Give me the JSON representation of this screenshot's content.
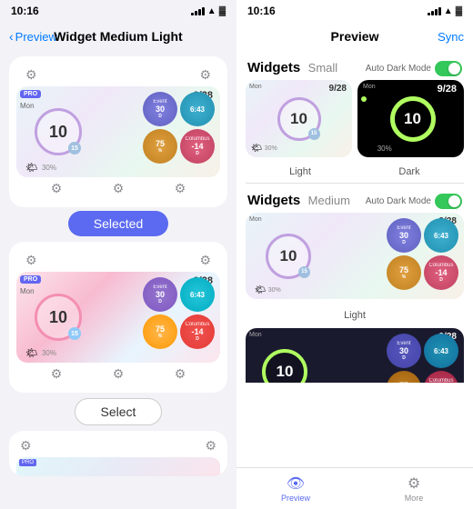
{
  "left": {
    "status_time": "10:16",
    "nav_back": "Preview",
    "nav_title": "Widget Medium Light",
    "widget1": {
      "pro_badge": "PRO",
      "day": "Mon",
      "date_day": "",
      "date_num": "9/28",
      "center_num": "10",
      "center_sub": "15",
      "event_label": "Event",
      "event_val": "30",
      "event_unit": "D",
      "time_val": "6:43",
      "pct_val": "75",
      "pct_unit": "%",
      "col_label": "Columbus",
      "col_val": "-14",
      "col_unit": "D",
      "weather_pct": "30%"
    },
    "selected_label": "Selected",
    "widget2": {
      "pro_badge": "PRO",
      "day": "Mon",
      "date_num": "9/28",
      "center_num": "10",
      "center_sub": "15",
      "event_label": "Event",
      "event_val": "30",
      "event_unit": "D",
      "time_val": "6:43",
      "pct_val": "75",
      "pct_unit": "%",
      "col_label": "Columbus",
      "col_val": "-14",
      "col_unit": "D",
      "weather_pct": "30%"
    },
    "select_label": "Select",
    "widget3": {
      "pro_badge": "PRO"
    }
  },
  "right": {
    "status_time": "10:16",
    "nav_title": "Preview",
    "nav_sync": "Sync",
    "section_small_label": "Widgets",
    "section_small_sub": "Small",
    "auto_dark_label": "Auto Dark Mode",
    "light_label": "Light",
    "dark_label": "Dark",
    "small_widget": {
      "day": "Mon",
      "date_num": "9/28",
      "center_num": "10",
      "center_sub": "15",
      "weather_pct": "30%"
    },
    "section_medium_label": "Widgets",
    "section_medium_sub": "Medium",
    "medium_light_label": "Light",
    "medium_widget": {
      "day": "Mon",
      "date_num": "9/28",
      "center_num": "10",
      "center_sub": "15",
      "event_label": "Event",
      "event_val": "30",
      "event_unit": "D",
      "time_val": "6:43",
      "pct_val": "75",
      "pct_unit": "%",
      "col_label": "Columbus",
      "col_val": "-14",
      "col_unit": "D",
      "weather_pct": "30%"
    },
    "tabs": [
      {
        "label": "Preview",
        "icon": "👁",
        "active": true
      },
      {
        "label": "More",
        "icon": "⚙",
        "active": false
      }
    ]
  }
}
